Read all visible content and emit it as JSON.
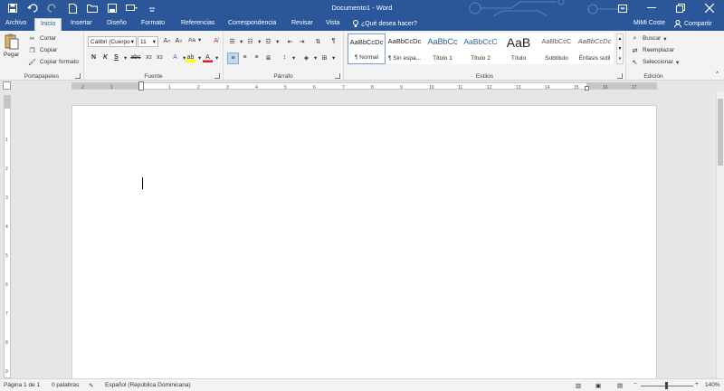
{
  "window": {
    "title": "Documento1 - Word"
  },
  "tabs": [
    "Archivo",
    "Inicio",
    "Insertar",
    "Diseño",
    "Formato",
    "Referencias",
    "Correspondencia",
    "Revisar",
    "Vista"
  ],
  "tell_me": "¿Qué desea hacer?",
  "user": "MiMi Coste",
  "share": "Compartir",
  "clipboard": {
    "label": "Portapapeles",
    "paste": "Pegar",
    "cut": "Cortar",
    "copy": "Copiar",
    "format_painter": "Copiar formato"
  },
  "font": {
    "label": "Fuente",
    "name": "Calibri (Cuerpo",
    "size": "11",
    "change_case": "Aa"
  },
  "paragraph": {
    "label": "Párrafo"
  },
  "styles": {
    "label": "Estilos",
    "items": [
      {
        "preview": "AaBbCcDc",
        "name": "¶ Normal"
      },
      {
        "preview": "AaBbCcDc",
        "name": "¶ Sin espa..."
      },
      {
        "preview": "AaBbCc",
        "name": "Título 1"
      },
      {
        "preview": "AaBbCcC",
        "name": "Título 2"
      },
      {
        "preview": "AaB",
        "name": "Título"
      },
      {
        "preview": "AaBbCcC",
        "name": "Subtítulo"
      },
      {
        "preview": "AaBbCcDc",
        "name": "Énfasis sutil"
      }
    ]
  },
  "editing": {
    "label": "Edición",
    "find": "Buscar",
    "replace": "Reemplazar",
    "select": "Seleccionar"
  },
  "status": {
    "page": "Página 1 de 1",
    "words": "0 palabras",
    "language": "Español (República Dominicana)",
    "zoom": "140%"
  },
  "colors": {
    "brand": "#2b579a"
  }
}
